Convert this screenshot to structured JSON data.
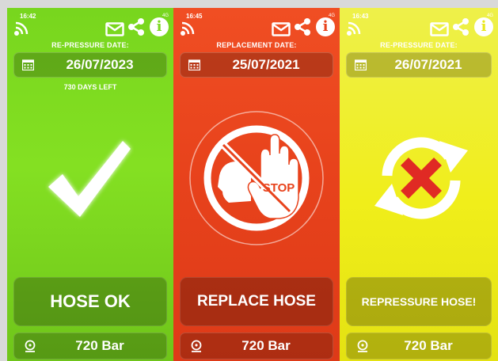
{
  "panels": [
    {
      "id": "green",
      "time": "16:42",
      "status_right": "4G",
      "date_label": "RE-PRESSURE DATE:",
      "date_value": "26/07/2023",
      "days_left": "730 DAYS LEFT",
      "status_label": "HOSE OK",
      "pressure": "720 Bar",
      "main_icon": "checkmark-icon",
      "color": "#7bd81e"
    },
    {
      "id": "red",
      "time": "16:45",
      "status_right": "4G",
      "date_label": "REPLACEMENT DATE:",
      "date_value": "25/07/2021",
      "stop_text": "STOP",
      "status_label": "REPLACE HOSE",
      "pressure": "720 Bar",
      "main_icon": "stop-hand-icon",
      "color": "#e8431c"
    },
    {
      "id": "yellow",
      "time": "16:43",
      "status_right": "4G",
      "date_label": "RE-PRESSURE DATE:",
      "date_value": "26/07/2021",
      "status_label": "REPRESSURE HOSE!",
      "pressure": "720 Bar",
      "main_icon": "repressure-cycle-icon",
      "color": "#e9e81a"
    }
  ],
  "icons": {
    "top_left": "nfc-signal-icon",
    "top_right": [
      "mail-icon",
      "share-icon",
      "info-icon"
    ],
    "date": "calendar-icon",
    "pressure": "pressure-gauge-icon"
  }
}
